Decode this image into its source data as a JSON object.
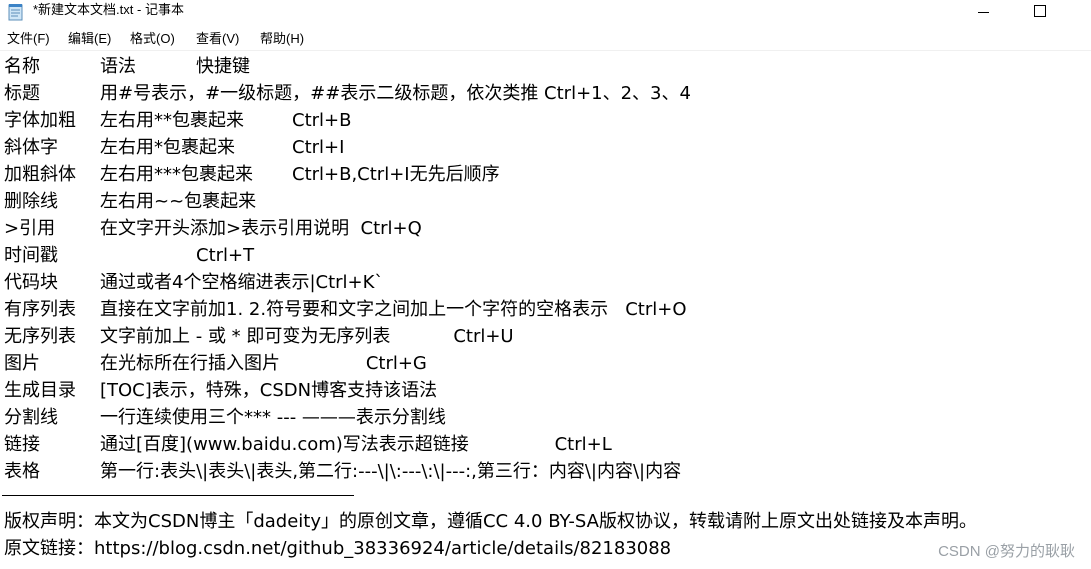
{
  "window": {
    "title": "*新建文本文档.txt - 记事本",
    "minimize_icon": "minimize-icon",
    "maximize_icon": "maximize-icon"
  },
  "menu": {
    "items": [
      "文件(F)",
      "编辑(E)",
      "格式(O)",
      "查看(V)",
      "帮助(H)"
    ]
  },
  "document": {
    "rows": [
      {
        "a": "名称",
        "b": "语法",
        "c": "快捷键"
      },
      {
        "a": "标题",
        "b": "用#号表示，#一级标题，##表示二级标题，依次类推 Ctrl+1、2、3、4",
        "c": ""
      },
      {
        "a": "字体加粗",
        "b": "左右用**包裹起来",
        "c": "Ctrl+B"
      },
      {
        "a": "斜体字",
        "b": "左右用*包裹起来",
        "c": "Ctrl+I"
      },
      {
        "a": "加粗斜体",
        "b": "左右用***包裹起来",
        "c": "Ctrl+B,Ctrl+I无先后顺序"
      },
      {
        "a": "删除线",
        "b": "左右用~~包裹起来",
        "c": ""
      },
      {
        "a": ">引用",
        "b": "在文字开头添加>表示引用说明  Ctrl+Q",
        "c": ""
      },
      {
        "a": "时间戳",
        "b": "",
        "c": "Ctrl+T"
      },
      {
        "a": "代码块",
        "b": "通过或者4个空格缩进表示|Ctrl+K`",
        "c": ""
      },
      {
        "a": "有序列表",
        "b": "直接在文字前加1. 2.符号要和文字之间加上一个字符的空格表示   Ctrl+O",
        "c": ""
      },
      {
        "a": "无序列表",
        "b": "文字前加上 - 或 * 即可变为无序列表           Ctrl+U",
        "c": ""
      },
      {
        "a": "图片",
        "b": "在光标所在行插入图片               Ctrl+G",
        "c": ""
      },
      {
        "a": "生成目录",
        "b": "[TOC]表示，特殊，CSDN博客支持该语法",
        "c": ""
      },
      {
        "a": "分割线",
        "b": "一行连续使用三个*** --- ———表示分割线",
        "c": ""
      },
      {
        "a": "链接",
        "b": "通过[百度](www.baidu.com)写法表示超链接               Ctrl+L",
        "c": ""
      },
      {
        "a": "表格",
        "b": "第一行:表头\\|表头\\|表头,第二行:---\\|\\:---\\:\\|---:,第三行：内容\\|内容\\|内容",
        "c": ""
      }
    ],
    "copyright": "版权声明：本文为CSDN博主「dadeity」的原创文章，遵循CC 4.0 BY-SA版权协议，转载请附上原文出处链接及本声明。",
    "source_link": "原文链接：https://blog.csdn.net/github_38336924/article/details/82183088"
  },
  "watermark": "CSDN @努力的耿耿"
}
